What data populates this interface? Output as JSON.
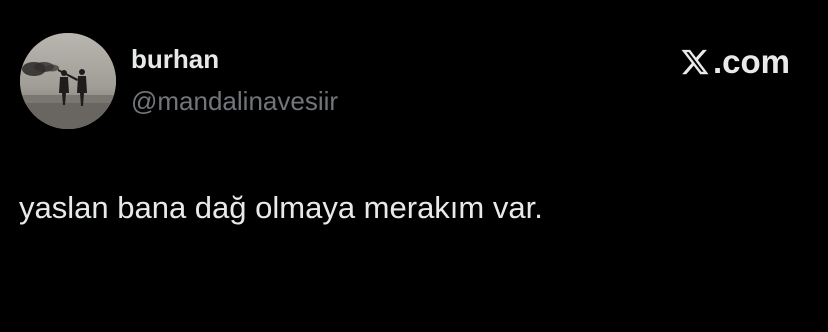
{
  "tweet": {
    "author": {
      "display_name": "burhan",
      "handle": "@mandalinavesiir",
      "avatar_icon": "avatar-photo-two-figures-smoke"
    },
    "brand": {
      "logo_icon": "x-logo-icon",
      "suffix": ".com"
    },
    "text": "yaslan bana dağ olmaya merakım var."
  },
  "colors": {
    "background": "#000000",
    "primary_text": "#e7e9ea",
    "secondary_text": "#71767b"
  }
}
